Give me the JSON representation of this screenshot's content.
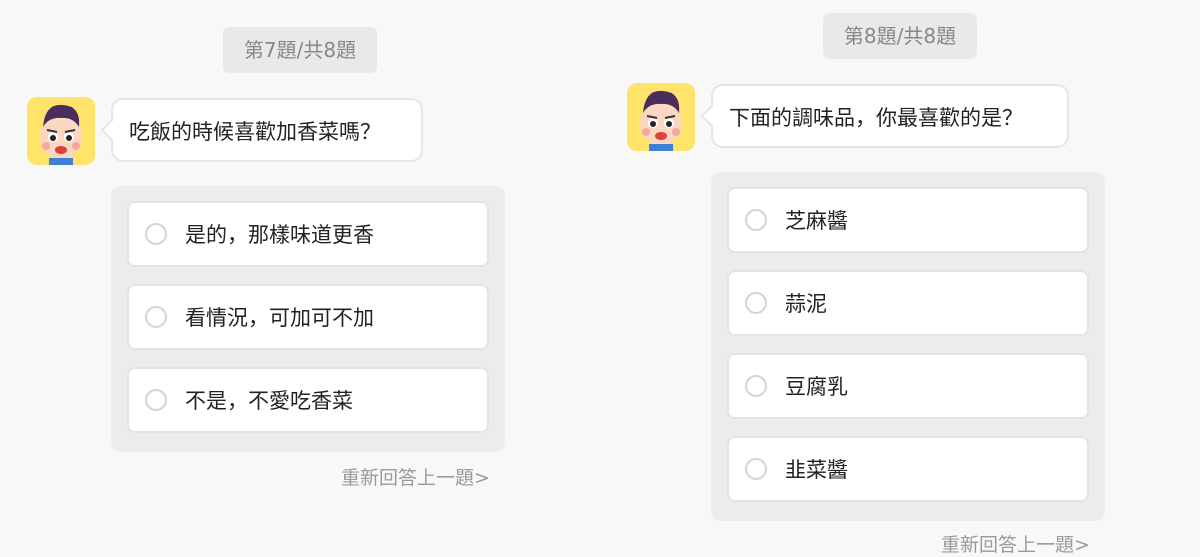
{
  "left_question": {
    "progress": "第7題/共8題",
    "question": "吃飯的時候喜歡加香菜嗎？",
    "options": [
      "是的，那樣味道更香",
      "看情況，可加可不加",
      "不是，不愛吃香菜"
    ],
    "redo_label": "重新回答上一題>"
  },
  "right_question": {
    "progress": "第8題/共8題",
    "question": "下面的調味品，你最喜歡的是？",
    "options": [
      "芝麻醬",
      "蒜泥",
      "豆腐乳",
      "韭菜醬"
    ],
    "redo_label": "重新回答上一題>"
  },
  "colors": {
    "avatar_bg": "#ffe36b",
    "panel_bg": "#ececec",
    "page_bg": "#f8f8f8"
  }
}
